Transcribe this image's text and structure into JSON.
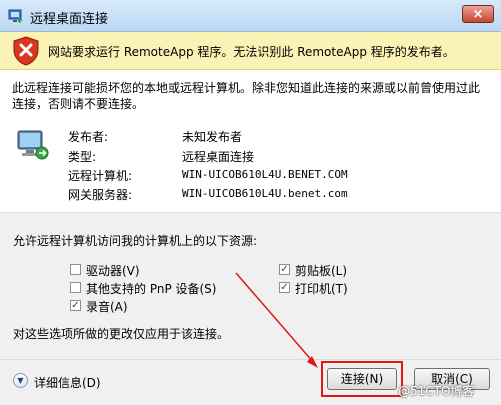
{
  "window": {
    "title": "远程桌面连接",
    "close_label": "×"
  },
  "warning": {
    "text": "网站要求运行 RemoteApp 程序。无法识别此 RemoteApp 程序的发布者。"
  },
  "description": {
    "line1": "此远程连接可能损坏您的本地或远程计算机。除非您知道此连接的来源或以前曾使用过此",
    "line2": "连接，否则请不要连接。"
  },
  "info": [
    {
      "label": "发布者:",
      "value": "未知发布者"
    },
    {
      "label": "类型:",
      "value": "远程桌面连接"
    },
    {
      "label": "远程计算机:",
      "value": "WIN-UICOB610L4U.BENET.COM"
    },
    {
      "label": "网关服务器:",
      "value": "WIN-UICOB610L4U.benet.com"
    }
  ],
  "resources": {
    "title": "允许远程计算机访问我的计算机上的以下资源:",
    "items": [
      {
        "label": "驱动器(V)",
        "checked": false
      },
      {
        "label": "其他支持的 PnP 设备(S)",
        "checked": false
      },
      {
        "label": "录音(A)",
        "checked": true
      },
      {
        "label": "剪贴板(L)",
        "checked": true
      },
      {
        "label": "打印机(T)",
        "checked": true
      }
    ],
    "check_mark": "✓",
    "note": "对这些选项所做的更改仅应用于该连接。"
  },
  "footer": {
    "details_label": "详细信息(D)",
    "details_icon": "chevron-down-circle-icon",
    "connect_label": "连接(N)",
    "cancel_label": "取消(C)",
    "watermark": "@51CTO博客"
  },
  "colors": {
    "warning_bg": "#fbf3b5",
    "highlight": "#e01818",
    "shield_red": "#d9381e"
  }
}
